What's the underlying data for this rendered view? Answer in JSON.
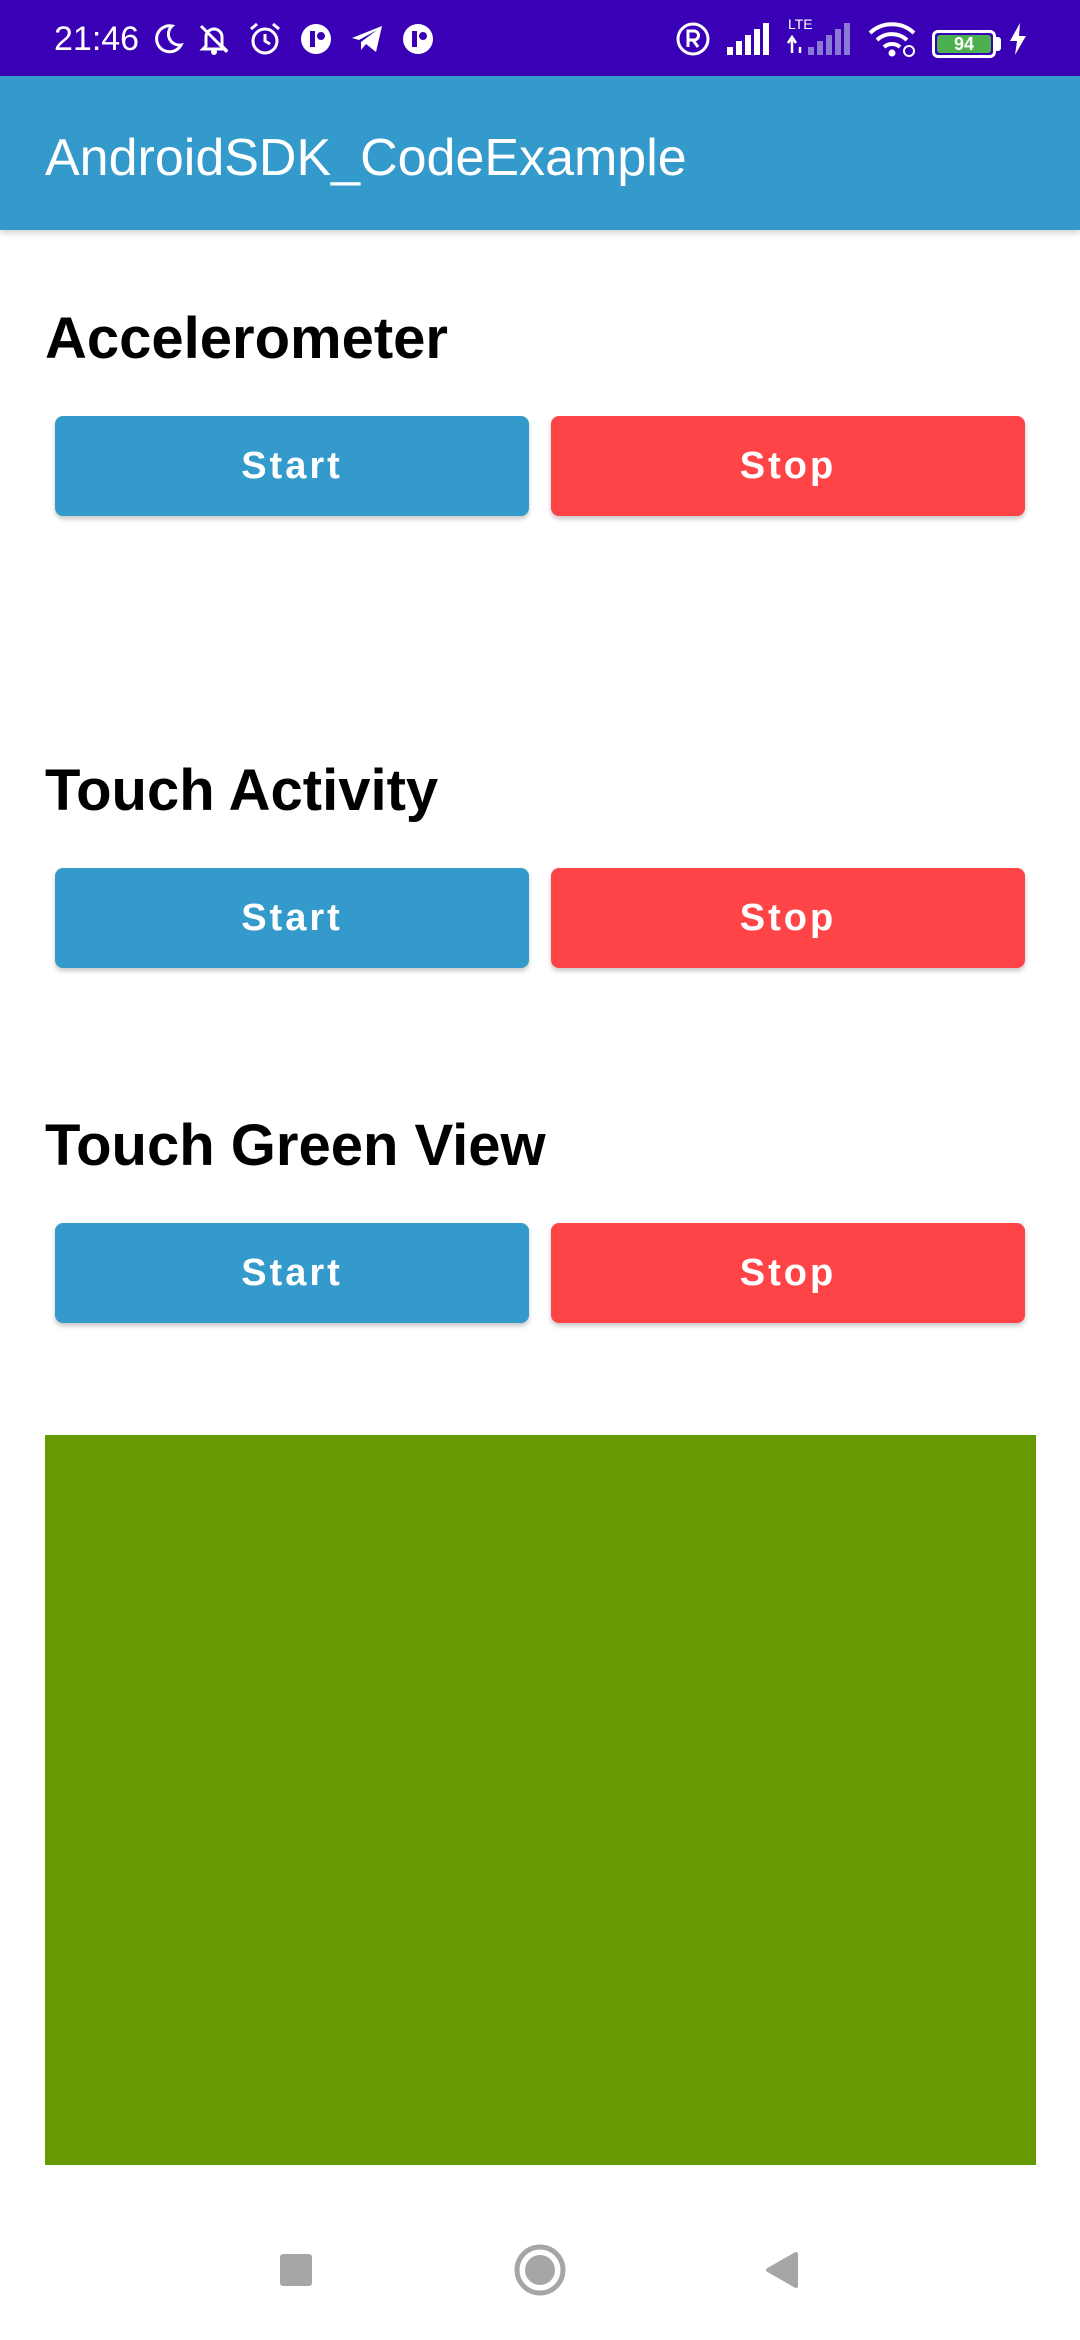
{
  "status_bar": {
    "time": "21:46",
    "battery_level": "94",
    "network_label": "LTE",
    "icons": [
      "moon-icon",
      "bell-off-icon",
      "alarm-icon",
      "app-icon",
      "telegram-icon",
      "app-icon",
      "registered-icon",
      "signal-icon",
      "lte-signal-icon",
      "wifi-icon",
      "battery-icon",
      "charging-icon"
    ]
  },
  "app_bar": {
    "title": "AndroidSDK_CodeExample"
  },
  "sections": [
    {
      "title": "Accelerometer",
      "start_label": "Start",
      "stop_label": "Stop"
    },
    {
      "title": "Touch Activity",
      "start_label": "Start",
      "stop_label": "Stop"
    },
    {
      "title": "Touch Green View",
      "start_label": "Start",
      "stop_label": "Stop"
    }
  ],
  "colors": {
    "status_bar": "#3a00b5",
    "app_bar": "#339acb",
    "start_button": "#339acb",
    "stop_button": "#ff4447",
    "green_view": "#679a01"
  },
  "nav_bar": {
    "icons": [
      "recents-square-icon",
      "home-circle-icon",
      "back-triangle-icon"
    ]
  }
}
